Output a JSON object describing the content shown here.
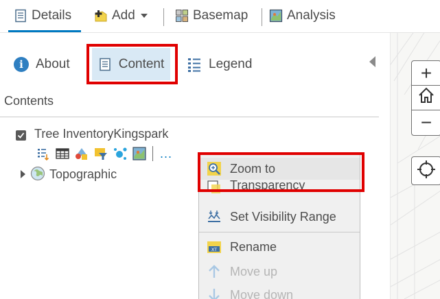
{
  "toolbar": {
    "details_label": "Details",
    "add_label": "Add",
    "basemap_label": "Basemap",
    "analysis_label": "Analysis"
  },
  "panel": {
    "tabs": {
      "about": "About",
      "content": "Content",
      "legend": "Legend"
    },
    "contents_heading": "Contents",
    "layers": [
      {
        "name": "Tree InventoryKingspark",
        "checked": true
      },
      {
        "name": "Topographic",
        "expanded": false
      }
    ],
    "more_label": "..."
  },
  "context_menu": {
    "items": [
      {
        "label": "Zoom to",
        "enabled": true
      },
      {
        "label": "Transparency",
        "enabled": true
      },
      {
        "label": "Set Visibility Range",
        "enabled": true
      },
      {
        "label": "Rename",
        "enabled": true
      },
      {
        "label": "Move up",
        "enabled": false
      },
      {
        "label": "Move down",
        "enabled": false
      }
    ]
  },
  "map_controls": {
    "zoom_in": "+",
    "zoom_out": "−"
  },
  "colors": {
    "accent": "#0079c1",
    "highlight": "#e00000",
    "active_tab_bg": "#d9e9f5",
    "menu_bg": "#f0f0f0"
  }
}
